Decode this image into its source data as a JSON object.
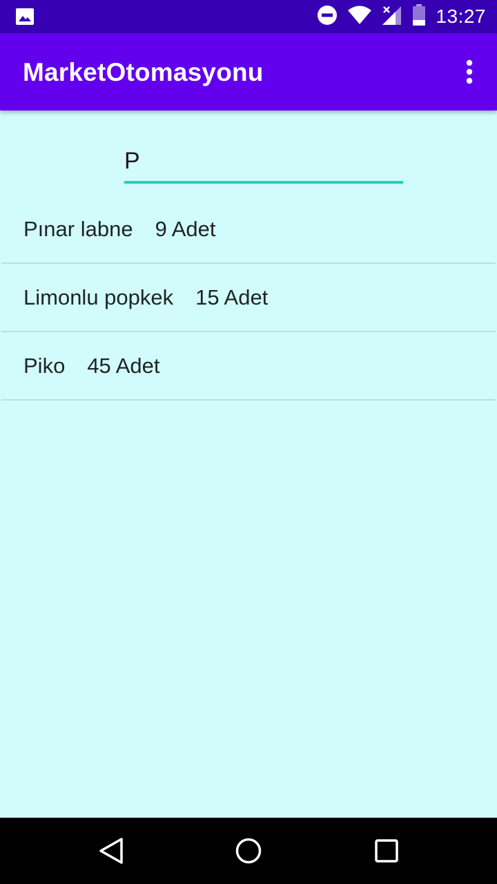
{
  "status_bar": {
    "time": "13:27",
    "icons": [
      "gallery-icon",
      "do-not-disturb-icon",
      "wifi-icon",
      "cell-signal-icon",
      "battery-icon"
    ]
  },
  "app_bar": {
    "title": "MarketOtomasyonu",
    "menu_icon": "more-vert-icon"
  },
  "search": {
    "value": "P",
    "placeholder": ""
  },
  "products": [
    {
      "name": "Pınar labne",
      "quantity": "9 Adet"
    },
    {
      "name": "Limonlu popkek",
      "quantity": "15 Adet"
    },
    {
      "name": "Piko",
      "quantity": "45 Adet"
    }
  ],
  "nav_bar": {
    "buttons": [
      "back-icon",
      "home-icon",
      "recents-icon"
    ]
  },
  "colors": {
    "status_bar": "#3700b3",
    "app_bar": "#6200ee",
    "background": "#d2fcfb",
    "accent": "#1ed3c0",
    "divider": "#bfdcdc"
  }
}
